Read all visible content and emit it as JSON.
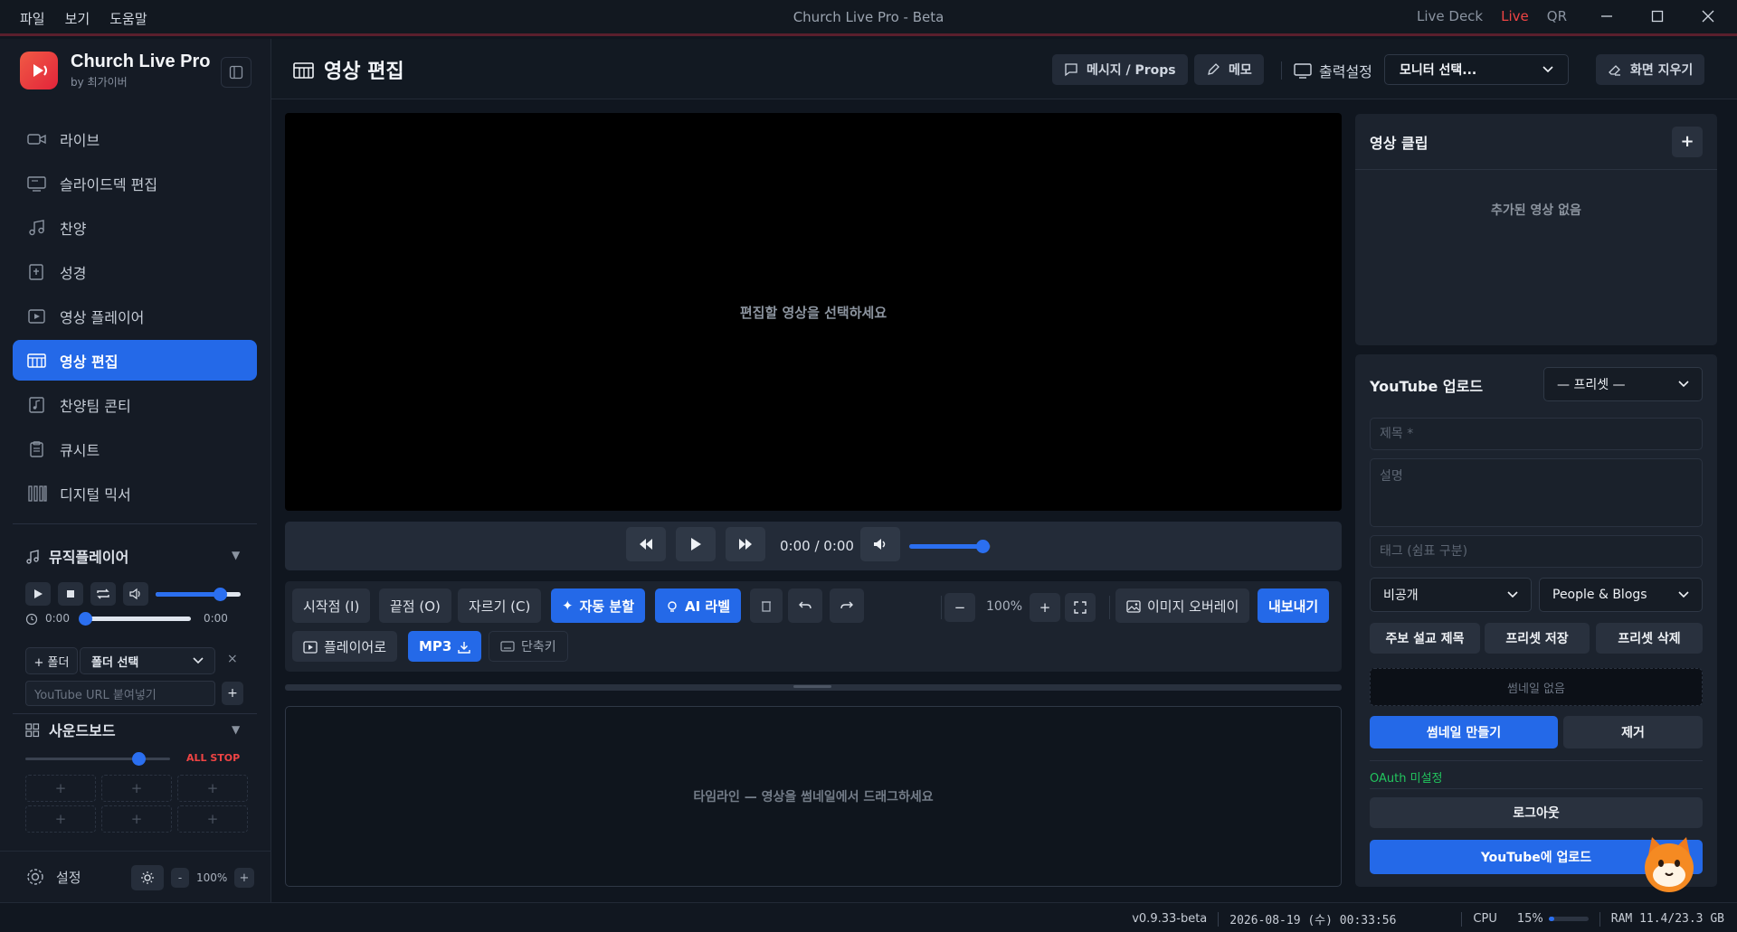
{
  "titlebar": {
    "menu": [
      "파일",
      "보기",
      "도움말"
    ],
    "title": "Church Live Pro - Beta",
    "live_deck": "Live Deck",
    "live": "Live",
    "qr": "QR"
  },
  "brand": {
    "name": "Church Live Pro",
    "by": "by 최가이버"
  },
  "nav": [
    {
      "label": "라이브",
      "icon": "video-camera-icon"
    },
    {
      "label": "슬라이드덱 편집",
      "icon": "monitor-icon"
    },
    {
      "label": "찬양",
      "icon": "music-note-icon"
    },
    {
      "label": "성경",
      "icon": "bible-icon"
    },
    {
      "label": "영상 플레이어",
      "icon": "play-square-icon"
    },
    {
      "label": "영상 편집",
      "icon": "film-edit-icon",
      "active": true
    },
    {
      "label": "찬양팀 콘티",
      "icon": "music-file-icon"
    },
    {
      "label": "큐시트",
      "icon": "clipboard-icon"
    },
    {
      "label": "디지털 믹서",
      "icon": "mixer-icon"
    }
  ],
  "music_player": {
    "title": "뮤직플레이어",
    "time_current": "0:00",
    "time_total": "0:00",
    "volume_level": 0.75,
    "folder_button": "+ 폴더",
    "folder_select": "폴더 선택",
    "close": "×",
    "url_placeholder": "YouTube URL 붙여넣기",
    "add": "+"
  },
  "soundboard": {
    "title": "사운드보드",
    "all_stop": "ALL STOP",
    "volume_level": 0.78,
    "pads": [
      "+",
      "+",
      "+",
      "+",
      "+",
      "+"
    ]
  },
  "settings": {
    "label": "설정",
    "minus": "-",
    "zoom": "100%",
    "plus": "+"
  },
  "header": {
    "title": "영상 편집",
    "message_btn": "메시지 / Props",
    "memo_btn": "메모",
    "output_label": "출력설정",
    "monitor_select": "모니터 선택...",
    "clear_btn": "화면 지우기"
  },
  "video": {
    "placeholder": "편집할 영상을 선택하세요"
  },
  "transport": {
    "time": "0:00 / 0:00",
    "volume_level": 0.9
  },
  "toolbar": {
    "start": "시작점 (I)",
    "end": "끝점 (O)",
    "cut": "자르기 (C)",
    "auto_split": "자동 분할",
    "ai_label": "AI 라벨",
    "zoom_minus": "−",
    "zoom": "100%",
    "zoom_plus": "+",
    "image_overlay": "이미지 오버레이",
    "export": "내보내기",
    "to_player": "플레이어로",
    "mp3": "MP3",
    "shortcuts": "단축키"
  },
  "timeline": {
    "placeholder": "타임라인 — 영상을 썸네일에서 드래그하세요"
  },
  "clips": {
    "title": "영상 클립",
    "add": "+",
    "empty": "추가된 영상 없음"
  },
  "youtube": {
    "title": "YouTube 업로드",
    "preset_select": "— 프리셋 —",
    "title_placeholder": "제목 *",
    "desc_placeholder": "설명",
    "tags_placeholder": "태그 (쉼표 구분)",
    "privacy": "비공개",
    "category": "People & Blogs",
    "weekly_title": "주보 설교 제목",
    "save_preset": "프리셋 저장",
    "delete_preset": "프리셋 삭제",
    "no_thumbnail": "썸네일 없음",
    "make_thumbnail": "썸네일 만들기",
    "remove": "제거",
    "oauth": "OAuth 미설정",
    "logout": "로그아웃",
    "upload": "YouTube에 업로드",
    "oauth_color": "#22c55e"
  },
  "status": {
    "version": "v0.9.33-beta",
    "datetime": "2026-08-19 (수) 00:33:56",
    "cpu_label": "CPU",
    "cpu_value": "15%",
    "cpu_level": 0.15,
    "ram": "RAM 11.4/23.3 GB"
  },
  "colors": {
    "accent": "#2469e8",
    "live": "#ef4444",
    "brand": "#e3243a"
  }
}
